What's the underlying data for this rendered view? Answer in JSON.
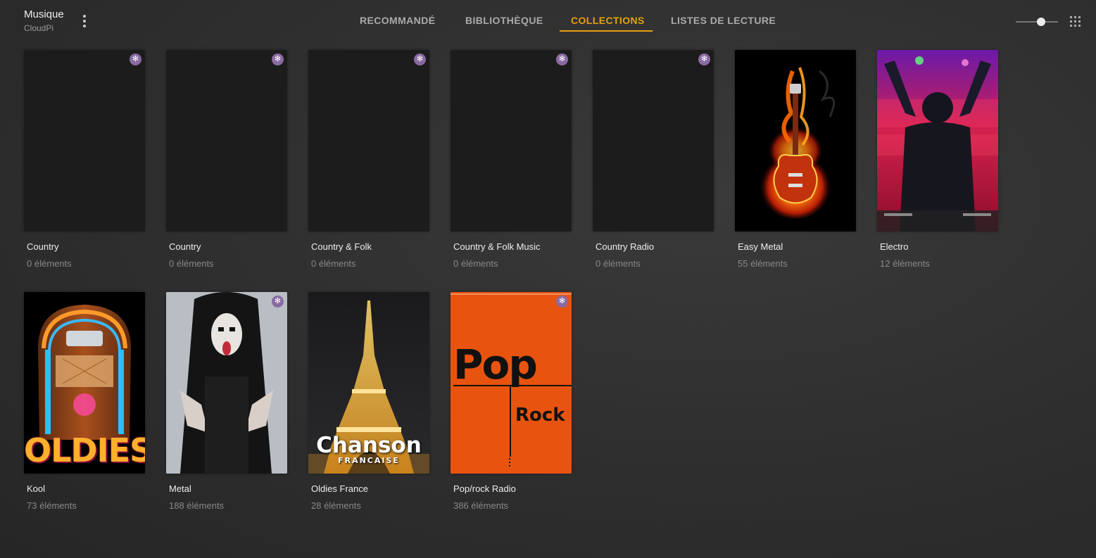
{
  "header": {
    "library_title": "Musique",
    "server_name": "CloudPi"
  },
  "tabs": [
    {
      "label": "RECOMMANDÉ",
      "active": false
    },
    {
      "label": "BIBLIOTHÈQUE",
      "active": false
    },
    {
      "label": "COLLECTIONS",
      "active": true
    },
    {
      "label": "LISTES DE LECTURE",
      "active": false
    }
  ],
  "colors": {
    "accent": "#e5a00d",
    "badge": "#8a6aa2",
    "background": "#303030"
  },
  "collections": [
    {
      "title": "Country",
      "count": "0 éléments",
      "artwork": "empty",
      "badge_icon": "gear-icon"
    },
    {
      "title": "Country",
      "count": "0 éléments",
      "artwork": "empty",
      "badge_icon": "gear-icon"
    },
    {
      "title": "Country & Folk",
      "count": "0 éléments",
      "artwork": "empty",
      "badge_icon": "gear-icon"
    },
    {
      "title": "Country & Folk Music",
      "count": "0 éléments",
      "artwork": "empty",
      "badge_icon": "gear-icon"
    },
    {
      "title": "Country Radio",
      "count": "0 éléments",
      "artwork": "empty",
      "badge_icon": "gear-icon"
    },
    {
      "title": "Easy Metal",
      "count": "55 éléments",
      "artwork": "flaming-guitar"
    },
    {
      "title": "Electro",
      "count": "12 éléments",
      "artwork": "dj-concert"
    },
    {
      "title": "Kool",
      "count": "73 éléments",
      "artwork": "jukebox",
      "art_text": "OLDIES"
    },
    {
      "title": "Metal",
      "count": "188 éléments",
      "artwork": "metal-singer",
      "badge_icon": "gear-icon"
    },
    {
      "title": "Oldies France",
      "count": "28 éléments",
      "artwork": "eiffel-tower",
      "art_text": "Chanson",
      "art_subtext": "FRANCAISE"
    },
    {
      "title": "Pop/rock Radio",
      "count": "386 éléments",
      "artwork": "pop-rock-orange",
      "art_text": "Pop",
      "art_subtext": "Rock",
      "badge_icon": "gear-icon"
    }
  ]
}
